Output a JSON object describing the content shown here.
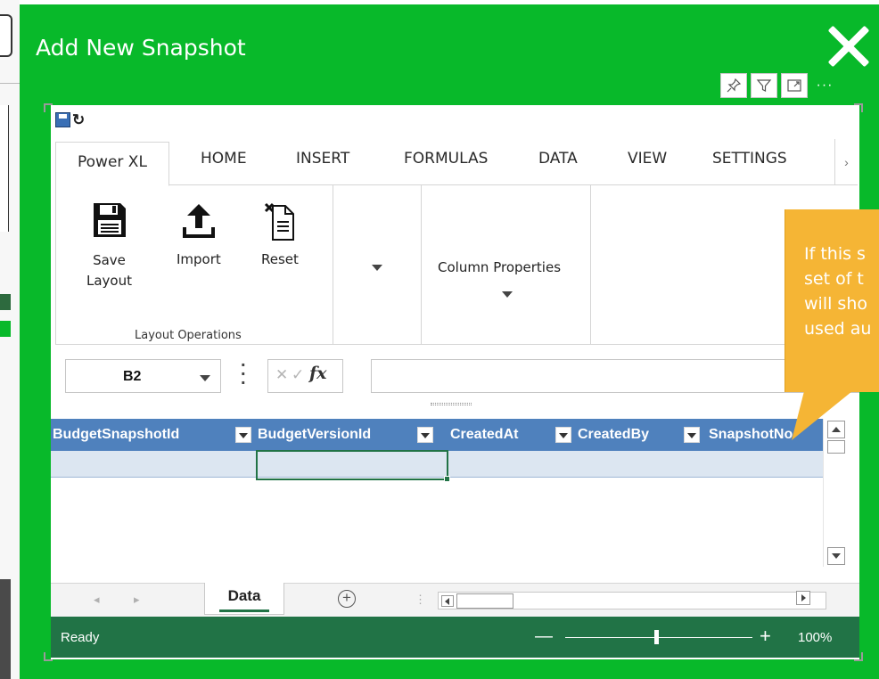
{
  "modal": {
    "title": "Add New Snapshot",
    "close_icon": "close-icon",
    "visual_tools": [
      "pin-icon",
      "filter-icon",
      "focus-mode-icon",
      "more-options-icon"
    ],
    "more_label": "···"
  },
  "excel": {
    "quick_access": [
      "save-icon",
      "undo-icon"
    ],
    "tabs": [
      {
        "label": "Power XL",
        "active": true
      },
      {
        "label": "HOME"
      },
      {
        "label": "INSERT"
      },
      {
        "label": "FORMULAS"
      },
      {
        "label": "DATA"
      },
      {
        "label": "VIEW"
      },
      {
        "label": "SETTINGS"
      }
    ],
    "tab_scroll": "›",
    "ribbon": {
      "save_label": "Save\nLayout",
      "import_label": "Import",
      "reset_label": "Reset",
      "group_label": "Layout Operations",
      "column_properties_label": "Column Properties"
    },
    "formula_bar": {
      "name_box": "B2",
      "cancel_symbol": "✕",
      "enter_symbol": "✓",
      "fx_symbol": "fx",
      "formula_value": ""
    },
    "grid": {
      "columns": [
        "BudgetSnapshotId",
        "BudgetVersionId",
        "CreatedAt",
        "CreatedBy",
        "SnapshotNo"
      ],
      "selected_cell": "B2",
      "rows": [
        [
          "",
          "",
          "",
          "",
          ""
        ]
      ]
    },
    "sheets": {
      "tabs": [
        "Data"
      ],
      "add_symbol": "+",
      "nav_left": "◂",
      "nav_right": "▸",
      "dots": "⋮"
    },
    "status": {
      "text": "Ready",
      "zoom_minus": "—",
      "zoom_plus": "+",
      "zoom": "100%",
      "zoom_fraction": 0.5
    }
  },
  "callout": {
    "lines": [
      "If this s",
      "set of t",
      "will sho",
      "used au"
    ],
    "color": "#f5b535"
  },
  "colors": {
    "modal_green": "#08b92a",
    "excel_green": "#217346",
    "header_blue": "#4f81bd",
    "row_blue": "#dce6f1"
  }
}
